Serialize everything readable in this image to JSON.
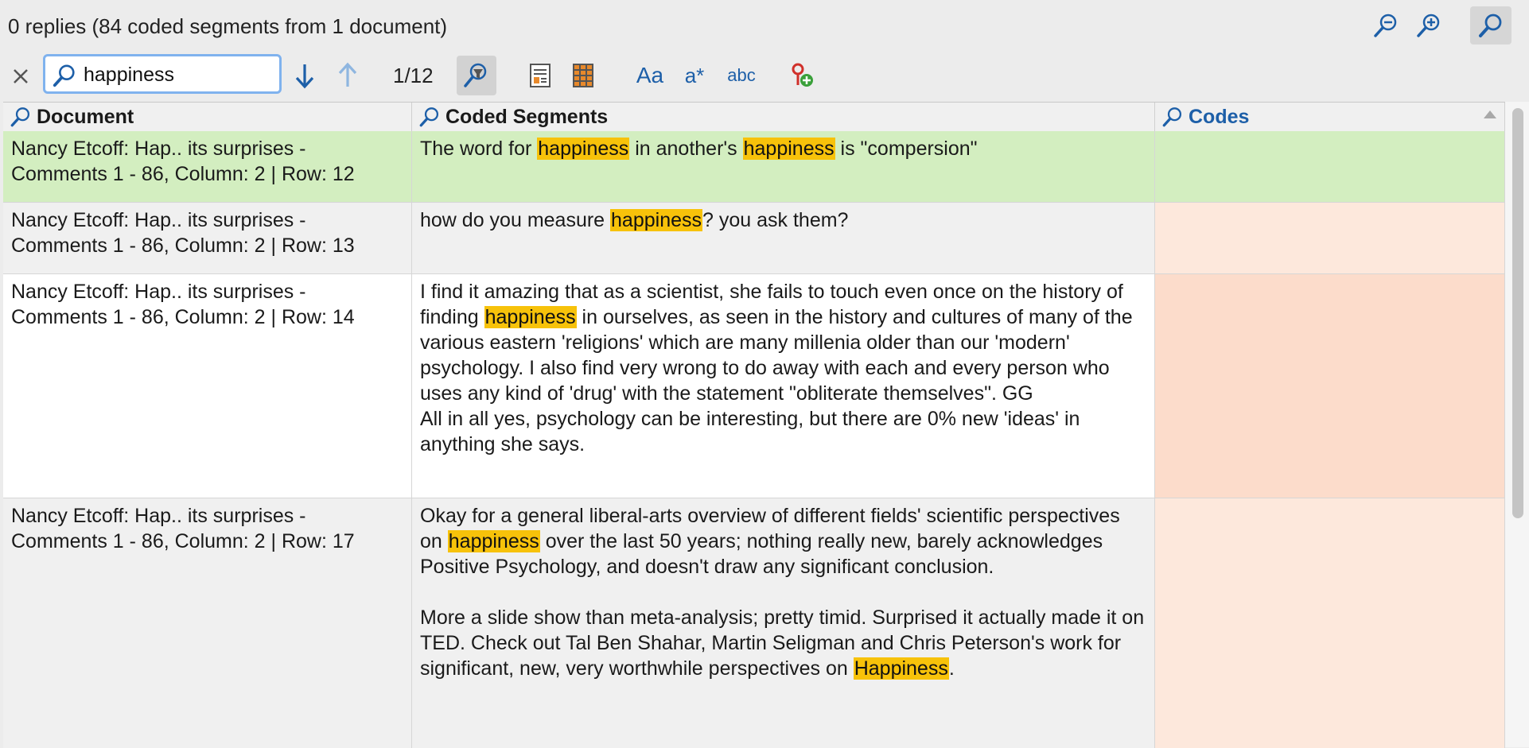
{
  "status": {
    "text": "0 replies (84 coded segments from 1 document)"
  },
  "search": {
    "value": "happiness",
    "counter": "1/12"
  },
  "toolbar": {
    "case_label": "Aa",
    "wildcard_label": "a*",
    "whole_word_label": "abc"
  },
  "table": {
    "headers": {
      "document": "Document",
      "segments": "Coded Segments",
      "codes": "Codes"
    },
    "rows": [
      {
        "document": "Nancy Etcoff: Hap.. its surprises - Comments 1 - 86, Column: 2 | Row: 12",
        "segment": "The word for happiness in another's happiness is \"compersion\"",
        "codes": ""
      },
      {
        "document": "Nancy Etcoff: Hap.. its surprises - Comments 1 - 86, Column: 2 | Row: 13",
        "segment": "how do you measure happiness? you ask them?",
        "codes": ""
      },
      {
        "document": "Nancy Etcoff: Hap.. its surprises - Comments 1 - 86, Column: 2 | Row: 14",
        "segment": "I find it amazing that as a scientist, she fails to touch even once on the history of finding happiness in ourselves, as seen in the history and cultures of many of the various eastern 'religions' which are many millenia older than our 'modern' psychology. I also find very wrong to do away with each and every person who uses any kind of 'drug' with the statement \"obliterate themselves\". GG\nAll in all yes, psychology can be interesting, but there are 0% new 'ideas' in anything she says.",
        "codes": ""
      },
      {
        "document": "Nancy Etcoff: Hap.. its surprises - Comments 1 - 86, Column: 2 | Row: 17",
        "segment": "Okay for a general liberal-arts overview of different fields' scientific perspectives on happiness over the last 50 years; nothing really new, barely acknowledges Positive Psychology, and doesn't draw any significant conclusion.\n\nMore a slide show than meta-analysis; pretty timid. Surprised it actually made it on TED. Check out Tal Ben Shahar, Martin Seligman and Chris Peterson's work for significant, new, very worthwhile perspectives on Happiness.",
        "codes": ""
      }
    ]
  },
  "colors": {
    "highlight": "#f7c20a",
    "selected_row": "#d3eec0",
    "accent_blue": "#1d5fa8",
    "codes_cell": "#fde8dc"
  }
}
